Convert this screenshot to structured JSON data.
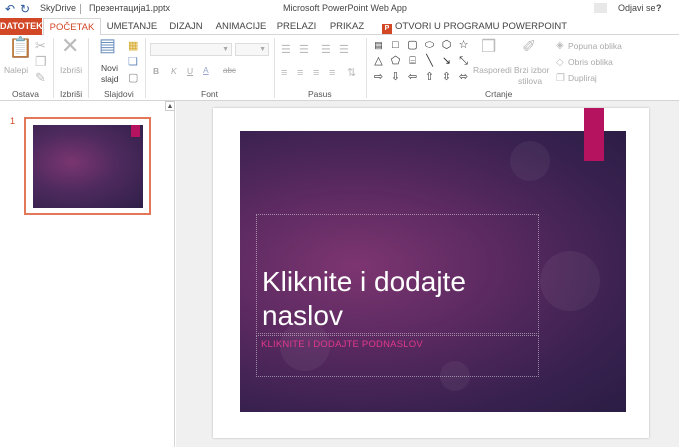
{
  "titlebar": {
    "app_location": "SkyDrive",
    "file_name": "Презентација1.pptx",
    "app_title": "Microsoft PowerPoint Web App",
    "sign_out": "Odjavi se",
    "help": "?"
  },
  "tabs": {
    "file": "DATOTEKA",
    "home": "POČETAK",
    "insert": "UMETANJE",
    "design": "DIZAJN",
    "animations": "ANIMACIJE",
    "transitions": "PRELAZI",
    "view": "PRIKAZ",
    "open_in_app": "OTVORI U PROGRAMU POWERPOINT",
    "ppt_badge": "P"
  },
  "ribbon": {
    "clipboard": {
      "group_label": "Ostava",
      "paste": "Nalepi"
    },
    "delete": {
      "group_label": "Izbriši",
      "delete": "Izbriši"
    },
    "slides": {
      "group_label": "Slajdovi",
      "new_slide_line1": "Novi",
      "new_slide_line2": "slajd"
    },
    "font": {
      "group_label": "Font",
      "bold": "B",
      "italic": "K",
      "underline": "U",
      "strike": "abc",
      "font_color": "A"
    },
    "paragraph": {
      "group_label": "Pasus"
    },
    "drawing": {
      "group_label": "Crtanje",
      "arrange": "Rasporedi",
      "quick_styles_line1": "Brzi izbor",
      "quick_styles_line2": "stilova",
      "shape_fill": "Popuna oblika",
      "shape_outline": "Obris oblika",
      "duplicate": "Dupliraj"
    }
  },
  "thumbnails": {
    "slide_number": "1"
  },
  "slide": {
    "title": "Kliknite i dodajte naslov",
    "subtitle": "KLIKNITE I DODAJTE PODNASLOV"
  },
  "colors": {
    "accent": "#d24726",
    "slide_dark": "#2a1d44",
    "slide_light": "#7d3571",
    "bookmark": "#b5135f",
    "subtitle": "#e0398b"
  }
}
